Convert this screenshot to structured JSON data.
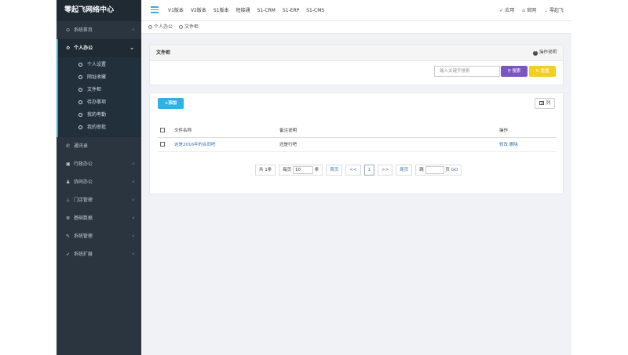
{
  "brand": {
    "title": "零起飞网络中心"
  },
  "sidebar": {
    "items": [
      {
        "icon": "gauge-icon",
        "label": "系统首页",
        "expanded": false
      },
      {
        "icon": "settings-icon",
        "label": "个人办公",
        "expanded": true,
        "children": [
          {
            "label": "个人设置"
          },
          {
            "label": "网址收藏"
          },
          {
            "label": "文件柜"
          },
          {
            "label": "待办事项"
          },
          {
            "label": "我的考勤"
          },
          {
            "label": "我的审批"
          }
        ]
      },
      {
        "icon": "phone-icon",
        "label": "通讯录"
      },
      {
        "icon": "briefcase-icon",
        "label": "行政办公"
      },
      {
        "icon": "users-icon",
        "label": "协同办公"
      },
      {
        "icon": "sitemap-icon",
        "label": "门店管理"
      },
      {
        "icon": "database-icon",
        "label": "基础数据"
      },
      {
        "icon": "wrench-icon",
        "label": "系统管理"
      },
      {
        "icon": "rocket-icon",
        "label": "系统扩展"
      }
    ]
  },
  "topnav": {
    "items": [
      "V1版本",
      "V2版本",
      "S1版本",
      "短接通",
      "S1-CRM",
      "S1-ERP",
      "S1-CMS"
    ]
  },
  "topright": {
    "apps": "应用",
    "site": "官网",
    "user": "零起飞"
  },
  "breadcrumb": {
    "items": [
      "个人办公",
      "文件柜"
    ]
  },
  "panel": {
    "title": "文件柜",
    "help": "操作说明",
    "search_placeholder": "输入关键字搜索",
    "search_btn": "搜索",
    "reset_btn": "重置"
  },
  "list": {
    "add_btn": "添加",
    "columns_btn": "列",
    "headers": [
      "文件名称",
      "备注说明",
      "操作"
    ],
    "rows": [
      {
        "name": "这是2016年的合同吧",
        "note": "还是行吧",
        "edit": "修改",
        "del": "删除"
      }
    ]
  },
  "pager": {
    "total_pre": "共",
    "total": "1",
    "total_unit": "条",
    "per_pre": "每页",
    "per": "10",
    "per_unit": "条",
    "first": "首页",
    "prev": "<<",
    "current": "1",
    "next": ">>",
    "last": "尾页",
    "jump_pre": "跳",
    "jump_unit": "页",
    "go": "GO"
  },
  "colors": {
    "accent": "#2fb1e3",
    "sidebar": "#2a3540",
    "search_btn": "#7b56c0",
    "reset_btn": "#f3ce24",
    "link": "#2f6fb0"
  }
}
